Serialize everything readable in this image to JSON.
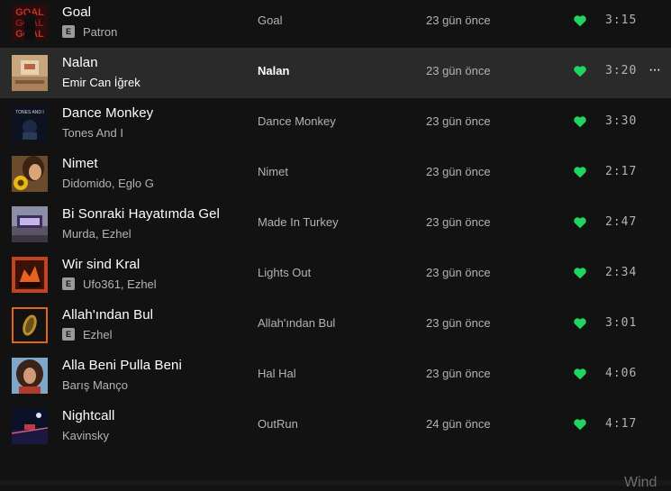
{
  "tracks": [
    {
      "title": "Goal",
      "explicit": true,
      "explicit_label": "E",
      "artist": "Patron",
      "album": "Goal",
      "date_added": "23 gün önce",
      "liked": true,
      "duration": "3:15",
      "cover_icon": "goal-cover-icon"
    },
    {
      "title": "Nalan",
      "explicit": false,
      "artist": "Emir Can İğrek",
      "album": "Nalan",
      "date_added": "23 gün önce",
      "liked": true,
      "duration": "3:20",
      "cover_icon": "nalan-cover-icon",
      "more_label": "···"
    },
    {
      "title": "Dance Monkey",
      "explicit": false,
      "artist": "Tones And I",
      "album": "Dance Monkey",
      "date_added": "23 gün önce",
      "liked": true,
      "duration": "3:30",
      "cover_icon": "dance-monkey-cover-icon",
      "cover_text": "TONES AND I"
    },
    {
      "title": "Nimet",
      "explicit": false,
      "artist": "Didomido, Eglo G",
      "album": "Nimet",
      "date_added": "23 gün önce",
      "liked": true,
      "duration": "2:17",
      "cover_icon": "nimet-cover-icon"
    },
    {
      "title": "Bi Sonraki Hayatımda Gel",
      "explicit": false,
      "artist": "Murda, Ezhel",
      "album": "Made In Turkey",
      "date_added": "23 gün önce",
      "liked": true,
      "duration": "2:47",
      "cover_icon": "made-in-turkey-cover-icon"
    },
    {
      "title": "Wir sind Kral",
      "explicit": true,
      "explicit_label": "E",
      "artist": "Ufo361, Ezhel",
      "album": "Lights Out",
      "date_added": "23 gün önce",
      "liked": true,
      "duration": "2:34",
      "cover_icon": "lights-out-cover-icon"
    },
    {
      "title": "Allah'ından Bul",
      "explicit": true,
      "explicit_label": "E",
      "artist": "Ezhel",
      "album": "Allah'ından Bul",
      "date_added": "23 gün önce",
      "liked": true,
      "duration": "3:01",
      "cover_icon": "allahindan-bul-cover-icon"
    },
    {
      "title": "Alla Beni Pulla Beni",
      "explicit": false,
      "artist": "Barış Manço",
      "album": "Hal Hal",
      "date_added": "23 gün önce",
      "liked": true,
      "duration": "4:06",
      "cover_icon": "hal-hal-cover-icon"
    },
    {
      "title": "Nightcall",
      "explicit": false,
      "artist": "Kavinsky",
      "album": "OutRun",
      "date_added": "24 gün önce",
      "liked": true,
      "duration": "4:17",
      "cover_icon": "outrun-cover-icon"
    }
  ],
  "hovered_row": 1,
  "colors": {
    "background": "#121212",
    "hover_row": "#2a2a2a",
    "liked_heart": "#1ed760",
    "primary_text": "#ffffff",
    "secondary_text": "#b3b3b3"
  },
  "watermark": "Wind"
}
